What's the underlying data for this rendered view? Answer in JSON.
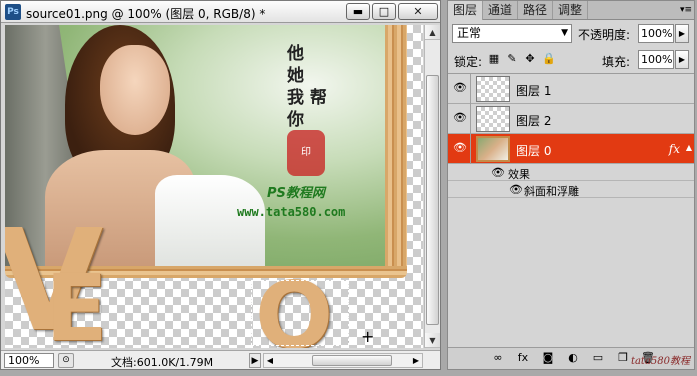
{
  "document": {
    "title": "source01.png @ 100% (图层 0, RGB/8) *",
    "app_icon": "Ps",
    "minimize_icon": "▬",
    "maximize_icon": "□",
    "close_icon": "✕",
    "zoom": "100%",
    "doc_size": "文档:601.0K/1.79M",
    "status_arrow": "▶",
    "scroll_left": "◀",
    "scroll_right": "▶",
    "scroll_up": "▲",
    "scroll_down": "▼"
  },
  "canvas": {
    "poem": "他\n她\n我 帮\n你",
    "seal": "印",
    "brand": "PS教程网",
    "url": "www.tata580.com",
    "letter_v": "V",
    "letter_e": "E",
    "letter_o": "O",
    "cursor": "+"
  },
  "panel": {
    "tabs": [
      "图层",
      "通道",
      "路径",
      "调整"
    ],
    "menu_icon": "▾≡",
    "blend_mode": "正常",
    "opacity_label": "不透明度:",
    "opacity": "100%",
    "lock_label": "锁定:",
    "fill_label": "填充:",
    "fill": "100%",
    "layers": [
      {
        "name": "图层 1"
      },
      {
        "name": "图层 2"
      },
      {
        "name": "图层 0",
        "fx": "fx"
      }
    ],
    "effects_label": "效果",
    "effect_name": "斜面和浮雕",
    "footer_icons": [
      "link-icon",
      "fx-icon",
      "mask-icon",
      "adjustment-icon",
      "group-icon",
      "new-layer-icon",
      "trash-icon"
    ],
    "watermark": "tata580教程"
  },
  "colors": {
    "selected_layer": "#e23a12"
  }
}
